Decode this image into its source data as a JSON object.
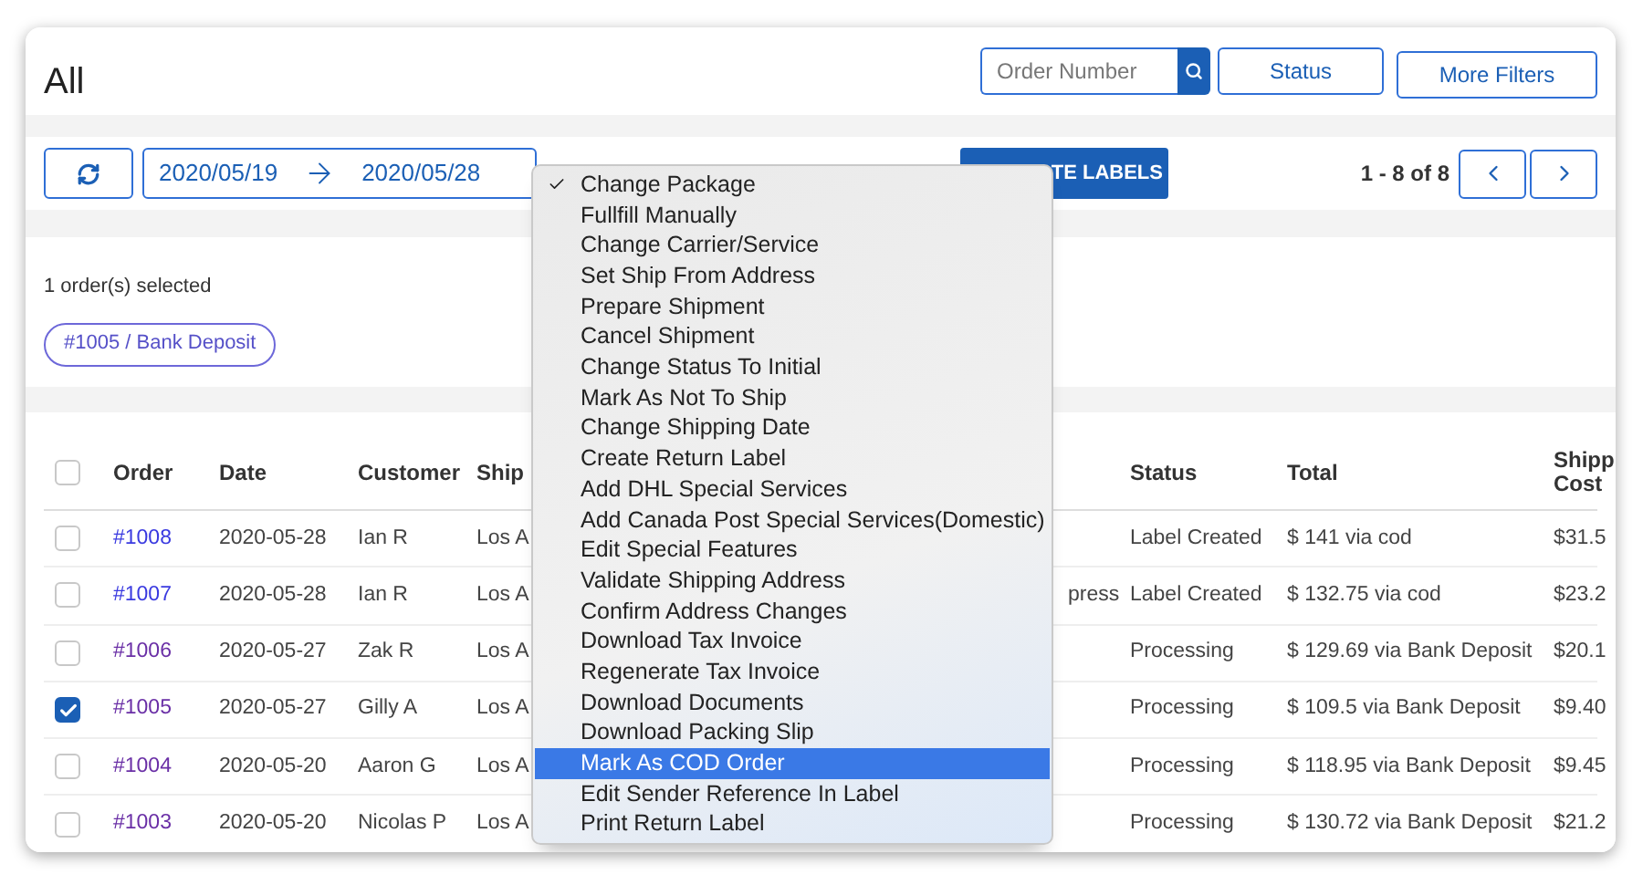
{
  "header": {
    "title": "All",
    "search": {
      "placeholder": "Order Number"
    },
    "buttons": [
      "Status",
      "More Filters"
    ]
  },
  "toolbar": {
    "date_from": "2020/05/19",
    "date_to": "2020/05/28",
    "create_labels_button": "TE LABELS",
    "pagination": "1 - 8 of 8"
  },
  "selection": {
    "summary": "1 order(s) selected",
    "chips": [
      "#1005 / Bank Deposit"
    ]
  },
  "table": {
    "all_checked": false,
    "columns": {
      "order": "Order",
      "date": "Date",
      "customer": "Customer",
      "ship_to": "Ship",
      "status": "Status",
      "total": "Total",
      "shipping_cost": "Shipp Cost"
    },
    "rows": [
      {
        "checked": false,
        "visited": false,
        "order": "#1008",
        "date": "2020-05-28",
        "customer": "Ian R",
        "ship_to": "Los A",
        "status": "Label Created",
        "total": "$ 141 via cod",
        "shipping_cost": "$31.5"
      },
      {
        "checked": false,
        "visited": false,
        "order": "#1007",
        "date": "2020-05-28",
        "customer": "Ian R",
        "ship_to": "Los A",
        "column_5": "press",
        "status": "Label Created",
        "total": "$ 132.75 via cod",
        "shipping_cost": "$23.2"
      },
      {
        "checked": false,
        "visited": true,
        "order": "#1006",
        "date": "2020-05-27",
        "customer": "Zak R",
        "ship_to": "Los A",
        "status": "Processing",
        "total": "$ 129.69 via Bank Deposit",
        "shipping_cost": "$20.1"
      },
      {
        "checked": true,
        "visited": true,
        "order": "#1005",
        "date": "2020-05-27",
        "customer": "Gilly A",
        "ship_to": "Los A",
        "status": "Processing",
        "total": "$ 109.5 via Bank Deposit",
        "shipping_cost": "$9.40"
      },
      {
        "checked": false,
        "visited": true,
        "order": "#1004",
        "date": "2020-05-20",
        "customer": "Aaron G",
        "ship_to": "Los A",
        "status": "Processing",
        "total": "$ 118.95 via Bank Deposit",
        "shipping_cost": "$9.45"
      },
      {
        "checked": false,
        "visited": true,
        "order": "#1003",
        "date": "2020-05-20",
        "customer": "Nicolas P",
        "ship_to": "Los A",
        "status": "Processing",
        "total": "$ 130.72 via Bank Deposit",
        "shipping_cost": "$21.2"
      }
    ]
  },
  "action_menu": {
    "items": [
      {
        "label": "Change Package",
        "checked": true,
        "selected": false
      },
      {
        "label": "Fullfill Manually",
        "checked": false,
        "selected": false
      },
      {
        "label": "Change Carrier/Service",
        "checked": false,
        "selected": false
      },
      {
        "label": "Set Ship From Address",
        "checked": false,
        "selected": false
      },
      {
        "label": "Prepare Shipment",
        "checked": false,
        "selected": false
      },
      {
        "label": "Cancel Shipment",
        "checked": false,
        "selected": false
      },
      {
        "label": "Change Status To Initial",
        "checked": false,
        "selected": false
      },
      {
        "label": "Mark As Not To Ship",
        "checked": false,
        "selected": false
      },
      {
        "label": "Change Shipping Date",
        "checked": false,
        "selected": false
      },
      {
        "label": "Create Return Label",
        "checked": false,
        "selected": false
      },
      {
        "label": "Add DHL Special Services",
        "checked": false,
        "selected": false
      },
      {
        "label": "Add Canada Post Special Services(Domestic)",
        "checked": false,
        "selected": false
      },
      {
        "label": "Edit Special Features",
        "checked": false,
        "selected": false
      },
      {
        "label": "Validate Shipping Address",
        "checked": false,
        "selected": false
      },
      {
        "label": "Confirm Address Changes",
        "checked": false,
        "selected": false
      },
      {
        "label": "Download Tax Invoice",
        "checked": false,
        "selected": false
      },
      {
        "label": "Regenerate Tax Invoice",
        "checked": false,
        "selected": false
      },
      {
        "label": "Download Documents",
        "checked": false,
        "selected": false
      },
      {
        "label": "Download Packing Slip",
        "checked": false,
        "selected": false
      },
      {
        "label": "Mark As COD Order",
        "checked": false,
        "selected": true
      },
      {
        "label": "Edit Sender Reference In Label",
        "checked": false,
        "selected": false
      },
      {
        "label": "Print Return Label",
        "checked": false,
        "selected": false
      }
    ]
  }
}
